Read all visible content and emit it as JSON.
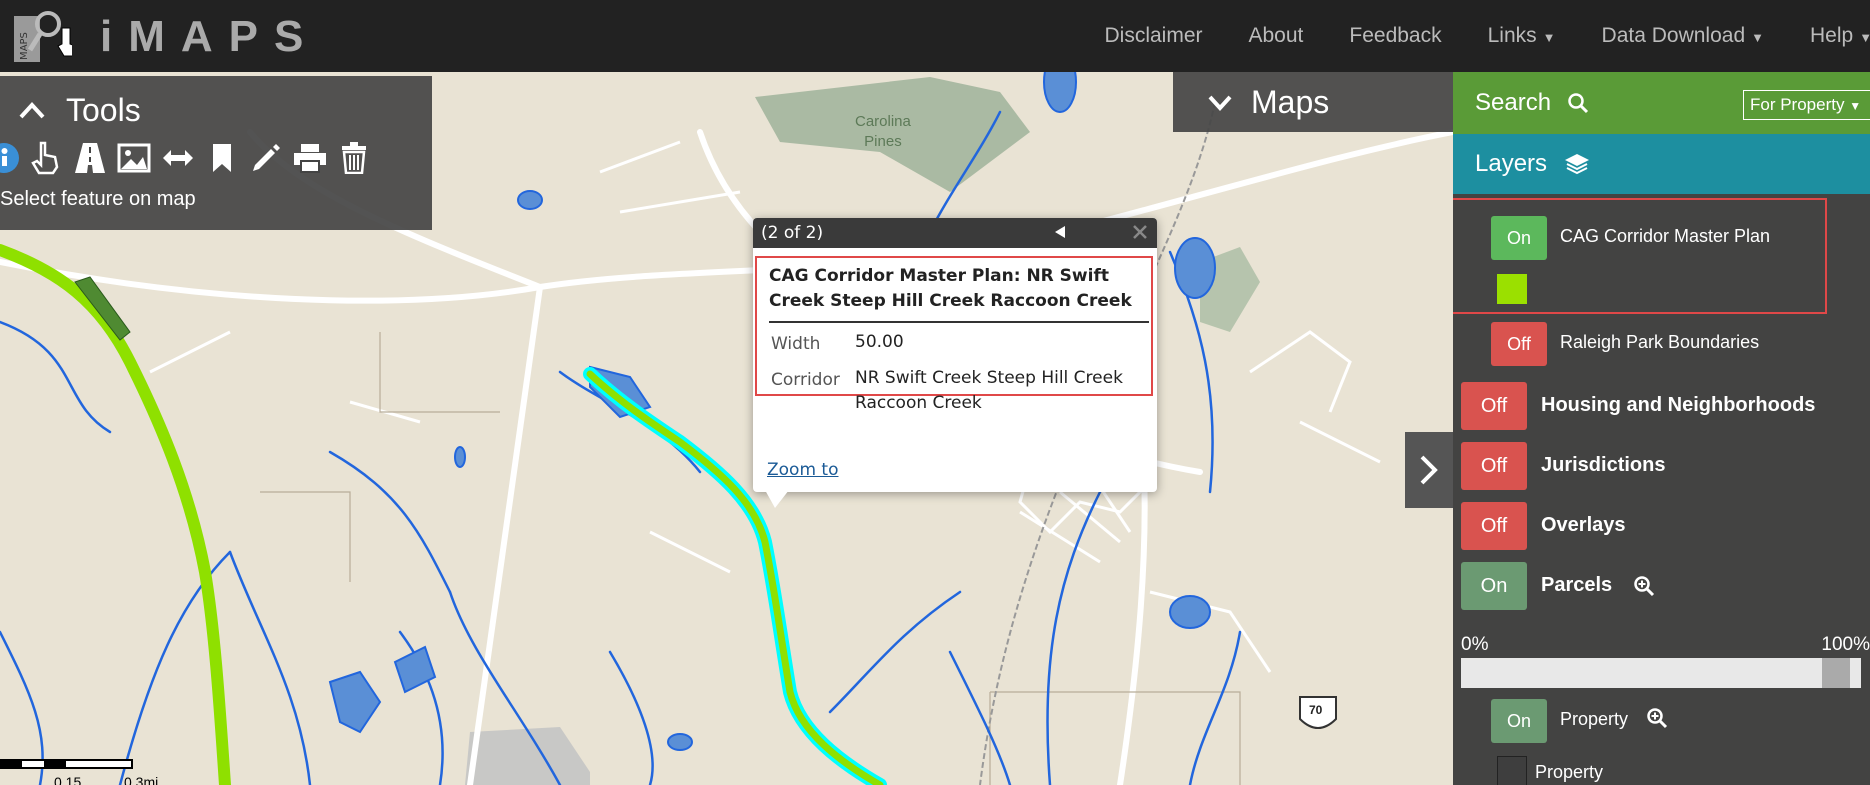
{
  "header": {
    "brand": "iMAPS",
    "nav": [
      {
        "label": "Disclaimer",
        "caret": false
      },
      {
        "label": "About",
        "caret": false
      },
      {
        "label": "Feedback",
        "caret": false
      },
      {
        "label": "Links",
        "caret": true
      },
      {
        "label": "Data Download",
        "caret": true
      },
      {
        "label": "Help",
        "caret": true
      }
    ]
  },
  "tools": {
    "title": "Tools",
    "hint": "Select feature on map",
    "icons": [
      "info-icon",
      "pointer-hand-icon",
      "road-icon",
      "image-icon",
      "measure-arrows-icon",
      "bookmark-icon",
      "pencil-icon",
      "print-icon",
      "trash-icon"
    ]
  },
  "maps": {
    "title": "Maps"
  },
  "map_labels": {
    "park": "Carolina\nPines",
    "park_line1": "Carolina",
    "park_line2": "Pines",
    "highway": "70"
  },
  "popup": {
    "counter": "(2 of 2)",
    "title": "CAG Corridor Master Plan: NR Swift Creek Steep Hill Creek Raccoon Creek",
    "title_line1": "CAG Corridor Master Plan: NR Swift",
    "title_line2": "Creek Steep Hill Creek Raccoon Creek",
    "fields": [
      {
        "key": "Width",
        "value": "50.00"
      },
      {
        "key": "Corridor",
        "value": "NR Swift Creek Steep Hill Creek Raccoon Creek"
      }
    ],
    "corridor_line1": "NR Swift Creek Steep Hill Creek",
    "corridor_line2": "Raccoon Creek",
    "zoom_label": "Zoom to"
  },
  "sidebar": {
    "search_label": "Search",
    "search_mode": "For Property",
    "layers_label": "Layers",
    "layers": [
      {
        "state": "On",
        "label": "CAG Corridor Master Plan",
        "swatch": "#9be000"
      },
      {
        "state": "Off",
        "label": "Raleigh Park Boundaries"
      }
    ],
    "groups": [
      {
        "state": "Off",
        "label": "Housing and Neighborhoods"
      },
      {
        "state": "Off",
        "label": "Jurisdictions"
      },
      {
        "state": "Off",
        "label": "Overlays"
      },
      {
        "state": "On",
        "label": "Parcels"
      }
    ],
    "opacity_min": "0%",
    "opacity_max": "100%",
    "opacity_value": 0.97,
    "sublayer": {
      "state": "On",
      "label": "Property"
    },
    "legend_label": "Property"
  },
  "scale": {
    "labels": [
      "0.15",
      "0.3mi"
    ]
  },
  "colors": {
    "search_bar": "#5a9b37",
    "layers_bar": "#1d8fa0",
    "on": "#5cb85c",
    "off": "#d9534f",
    "corridor": "#8fe000",
    "highlight": "#00ffff",
    "stream": "#2266dd"
  }
}
